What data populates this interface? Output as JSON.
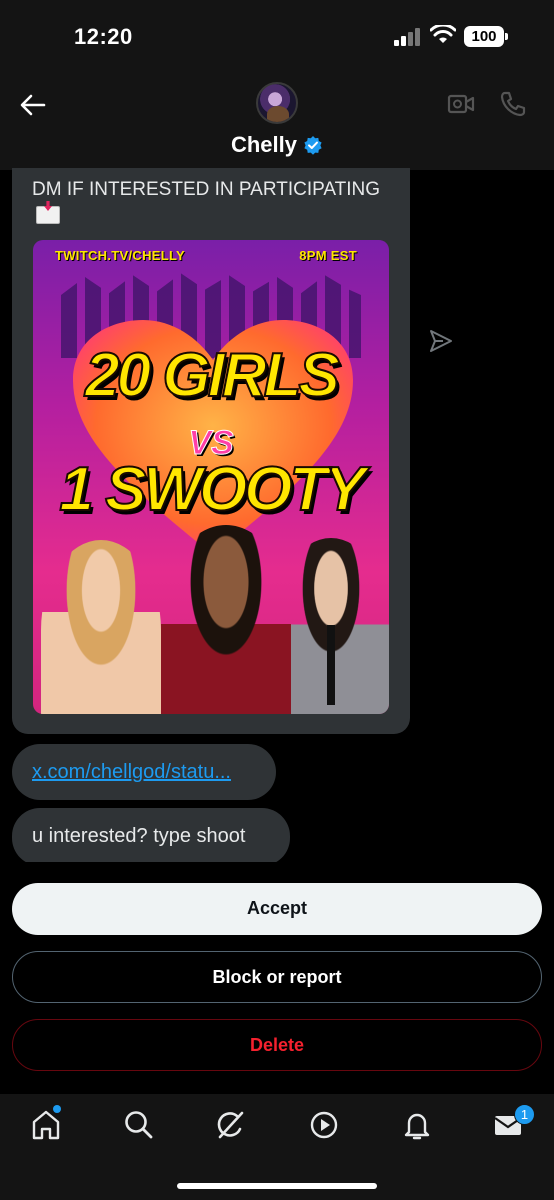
{
  "status_bar": {
    "time": "12:20",
    "battery": "100"
  },
  "header": {
    "name": "Chelly"
  },
  "messages": {
    "card_text": "DM IF INTERESTED IN PARTICIPATING",
    "poster": {
      "top_left": "TWITCH.TV/CHELLY",
      "top_right": "8PM EST",
      "line1": "20 GIRLS",
      "line2": "VS",
      "line3": "1 SWOOTY"
    },
    "link": "x.com/chellgod/statu...",
    "text": "u interested? type shoot"
  },
  "actions": {
    "accept": "Accept",
    "block": "Block or report",
    "delete": "Delete"
  },
  "tabbar": {
    "messages_badge": "1"
  },
  "colors": {
    "accent": "#1d9bf0",
    "danger": "#f4212e",
    "bubble": "#2f3336",
    "header": "#141414"
  }
}
